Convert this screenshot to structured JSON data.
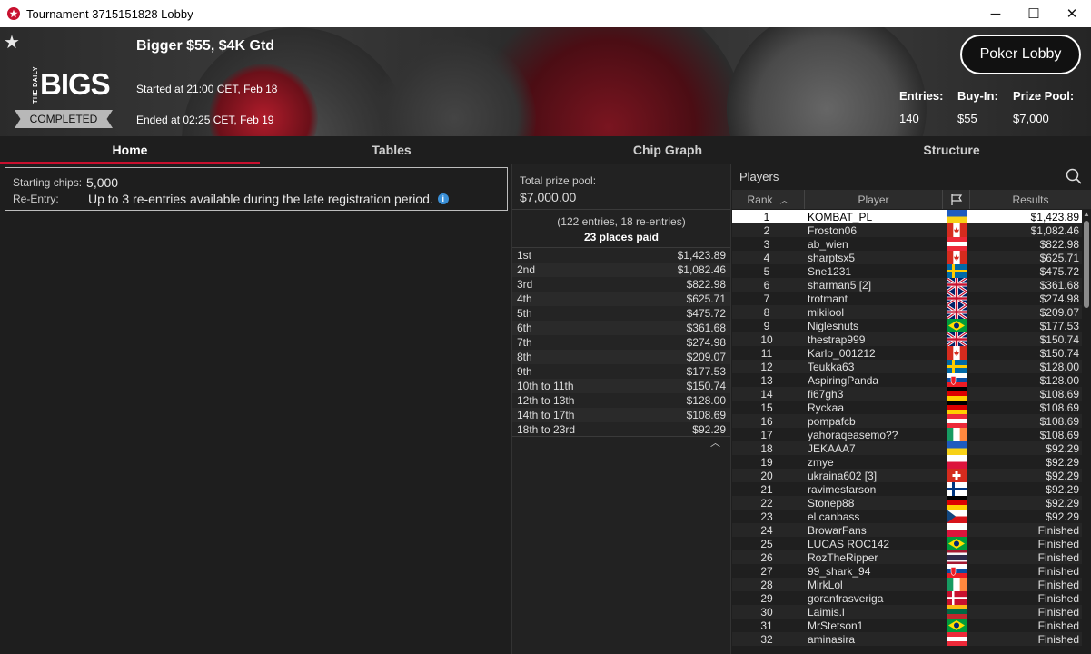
{
  "window": {
    "title": "Tournament 3715151828 Lobby",
    "minimize": "─",
    "maximize": "☐",
    "close": "✕"
  },
  "header": {
    "tournament_name": "Bigger $55, $4K Gtd",
    "started": "Started at 21:00 CET, Feb 18",
    "ended": "Ended at 02:25 CET, Feb 19",
    "status": "COMPLETED",
    "logo_small": "THE DAILY",
    "logo_big": "BIGS",
    "lobby_button": "Poker Lobby",
    "entries_label": "Entries:",
    "entries_value": "140",
    "buyin_label": "Buy-In:",
    "buyin_value": "$55",
    "prizepool_label": "Prize Pool:",
    "prizepool_value": "$7,000"
  },
  "tabs": [
    "Home",
    "Tables",
    "Chip Graph",
    "Structure"
  ],
  "home": {
    "starting_chips_label": "Starting chips:",
    "starting_chips_value": "5,000",
    "reentry_label": "Re-Entry:",
    "reentry_value": "Up to 3 re-entries available during the late registration period.",
    "info_icon": "i"
  },
  "prizes": {
    "total_label": "Total prize pool:",
    "total_value": "$7,000.00",
    "entries_line": "(122 entries, 18 re-entries)",
    "places_line": "23 places paid",
    "rows": [
      {
        "place": "1st",
        "amount": "$1,423.89"
      },
      {
        "place": "2nd",
        "amount": "$1,082.46"
      },
      {
        "place": "3rd",
        "amount": "$822.98"
      },
      {
        "place": "4th",
        "amount": "$625.71"
      },
      {
        "place": "5th",
        "amount": "$475.72"
      },
      {
        "place": "6th",
        "amount": "$361.68"
      },
      {
        "place": "7th",
        "amount": "$274.98"
      },
      {
        "place": "8th",
        "amount": "$209.07"
      },
      {
        "place": "9th",
        "amount": "$177.53"
      },
      {
        "place": "10th to 11th",
        "amount": "$150.74"
      },
      {
        "place": "12th to 13th",
        "amount": "$128.00"
      },
      {
        "place": "14th to 17th",
        "amount": "$108.69"
      },
      {
        "place": "18th to 23rd",
        "amount": "$92.29"
      }
    ]
  },
  "players": {
    "title": "Players",
    "col_rank": "Rank",
    "col_player": "Player",
    "col_results": "Results",
    "rows": [
      {
        "rank": "1",
        "name": "KOMBAT_PL",
        "flag": "ukraine",
        "result": "$1,423.89"
      },
      {
        "rank": "2",
        "name": "Froston06",
        "flag": "canada",
        "result": "$1,082.46"
      },
      {
        "rank": "3",
        "name": "ab_wien",
        "flag": "austria",
        "result": "$822.98"
      },
      {
        "rank": "4",
        "name": "sharptsx5",
        "flag": "canada",
        "result": "$625.71"
      },
      {
        "rank": "5",
        "name": "Sne1231",
        "flag": "sweden",
        "result": "$475.72"
      },
      {
        "rank": "6",
        "name": "sharman5 [2]",
        "flag": "uk",
        "result": "$361.68"
      },
      {
        "rank": "7",
        "name": "trotmant",
        "flag": "uk",
        "result": "$274.98"
      },
      {
        "rank": "8",
        "name": "mikilool",
        "flag": "uk",
        "result": "$209.07"
      },
      {
        "rank": "9",
        "name": "Niglesnuts",
        "flag": "brazil",
        "result": "$177.53"
      },
      {
        "rank": "10",
        "name": "thestrap999",
        "flag": "uk",
        "result": "$150.74"
      },
      {
        "rank": "11",
        "name": "Karlo_001212",
        "flag": "canada",
        "result": "$150.74"
      },
      {
        "rank": "12",
        "name": "Teukka63",
        "flag": "sweden",
        "result": "$128.00"
      },
      {
        "rank": "13",
        "name": "AspiringPanda",
        "flag": "slovakia",
        "result": "$128.00"
      },
      {
        "rank": "14",
        "name": "fi67gh3",
        "flag": "germany",
        "result": "$108.69"
      },
      {
        "rank": "15",
        "name": "Ryckaa",
        "flag": "germany",
        "result": "$108.69"
      },
      {
        "rank": "16",
        "name": "pompafcb",
        "flag": "austria",
        "result": "$108.69"
      },
      {
        "rank": "17",
        "name": "yahoraqeasemo??",
        "flag": "ireland",
        "result": "$108.69"
      },
      {
        "rank": "18",
        "name": "JEKAAA7",
        "flag": "ukraine",
        "result": "$92.29"
      },
      {
        "rank": "19",
        "name": "zmye",
        "flag": "poland",
        "result": "$92.29"
      },
      {
        "rank": "20",
        "name": "ukraina602 [3]",
        "flag": "switzerland",
        "result": "$92.29"
      },
      {
        "rank": "21",
        "name": "ravimestarson",
        "flag": "finland",
        "result": "$92.29"
      },
      {
        "rank": "22",
        "name": "Stonep88",
        "flag": "germany",
        "result": "$92.29"
      },
      {
        "rank": "23",
        "name": "el canbass",
        "flag": "czech",
        "result": "$92.29"
      },
      {
        "rank": "24",
        "name": "BrowarFans",
        "flag": "poland",
        "result": "Finished"
      },
      {
        "rank": "25",
        "name": "LUCAS ROC142",
        "flag": "brazil",
        "result": "Finished"
      },
      {
        "rank": "26",
        "name": "RozTheRipper",
        "flag": "thailand",
        "result": "Finished"
      },
      {
        "rank": "27",
        "name": "99_shark_94",
        "flag": "slovakia",
        "result": "Finished"
      },
      {
        "rank": "28",
        "name": "MirkLol",
        "flag": "ireland",
        "result": "Finished"
      },
      {
        "rank": "29",
        "name": "goranfrasveriga",
        "flag": "denmark",
        "result": "Finished"
      },
      {
        "rank": "30",
        "name": "Laimis.l",
        "flag": "lithuania",
        "result": "Finished"
      },
      {
        "rank": "31",
        "name": "MrStetson1",
        "flag": "brazil",
        "result": "Finished"
      },
      {
        "rank": "32",
        "name": "aminasira",
        "flag": "austria",
        "result": "Finished"
      }
    ]
  },
  "colors": {
    "accent": "#c8102e",
    "background": "#1e1e1e",
    "info": "#3a8fd6"
  }
}
